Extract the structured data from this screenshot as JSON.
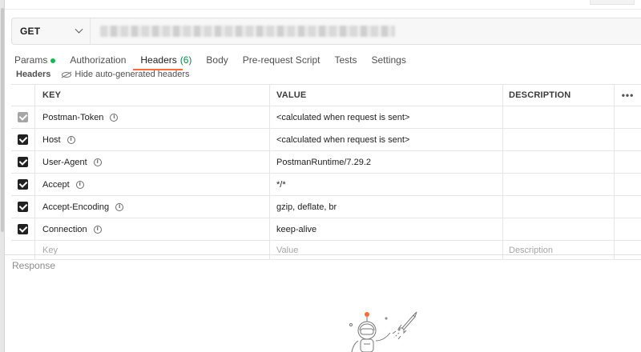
{
  "request": {
    "method": "GET"
  },
  "tabs": [
    {
      "label": "Params",
      "dot": true
    },
    {
      "label": "Authorization"
    },
    {
      "label": "Headers",
      "count": "(6)",
      "active": true
    },
    {
      "label": "Body"
    },
    {
      "label": "Pre-request Script"
    },
    {
      "label": "Tests"
    },
    {
      "label": "Settings"
    }
  ],
  "headers_section": {
    "title": "Headers",
    "hide_label": "Hide auto-generated headers"
  },
  "table": {
    "columns": [
      "KEY",
      "VALUE",
      "DESCRIPTION"
    ],
    "more_label": "•••",
    "rows": [
      {
        "key": "Postman-Token",
        "value": "<calculated when request is sent>",
        "description": "",
        "checked": true,
        "disabled": true
      },
      {
        "key": "Host",
        "value": "<calculated when request is sent>",
        "description": "",
        "checked": true
      },
      {
        "key": "User-Agent",
        "value": "PostmanRuntime/7.29.2",
        "description": "",
        "checked": true
      },
      {
        "key": "Accept",
        "value": "*/*",
        "description": "",
        "checked": true
      },
      {
        "key": "Accept-Encoding",
        "value": "gzip, deflate, br",
        "description": "",
        "checked": true
      },
      {
        "key": "Connection",
        "value": "keep-alive",
        "description": "",
        "checked": true
      }
    ],
    "placeholders": {
      "key": "Key",
      "value": "Value",
      "description": "Description"
    }
  },
  "response": {
    "label": "Response"
  },
  "colors": {
    "accent": "#ff6c37",
    "count_green": "#0a8a4b",
    "dot_green": "#0cbb52"
  }
}
